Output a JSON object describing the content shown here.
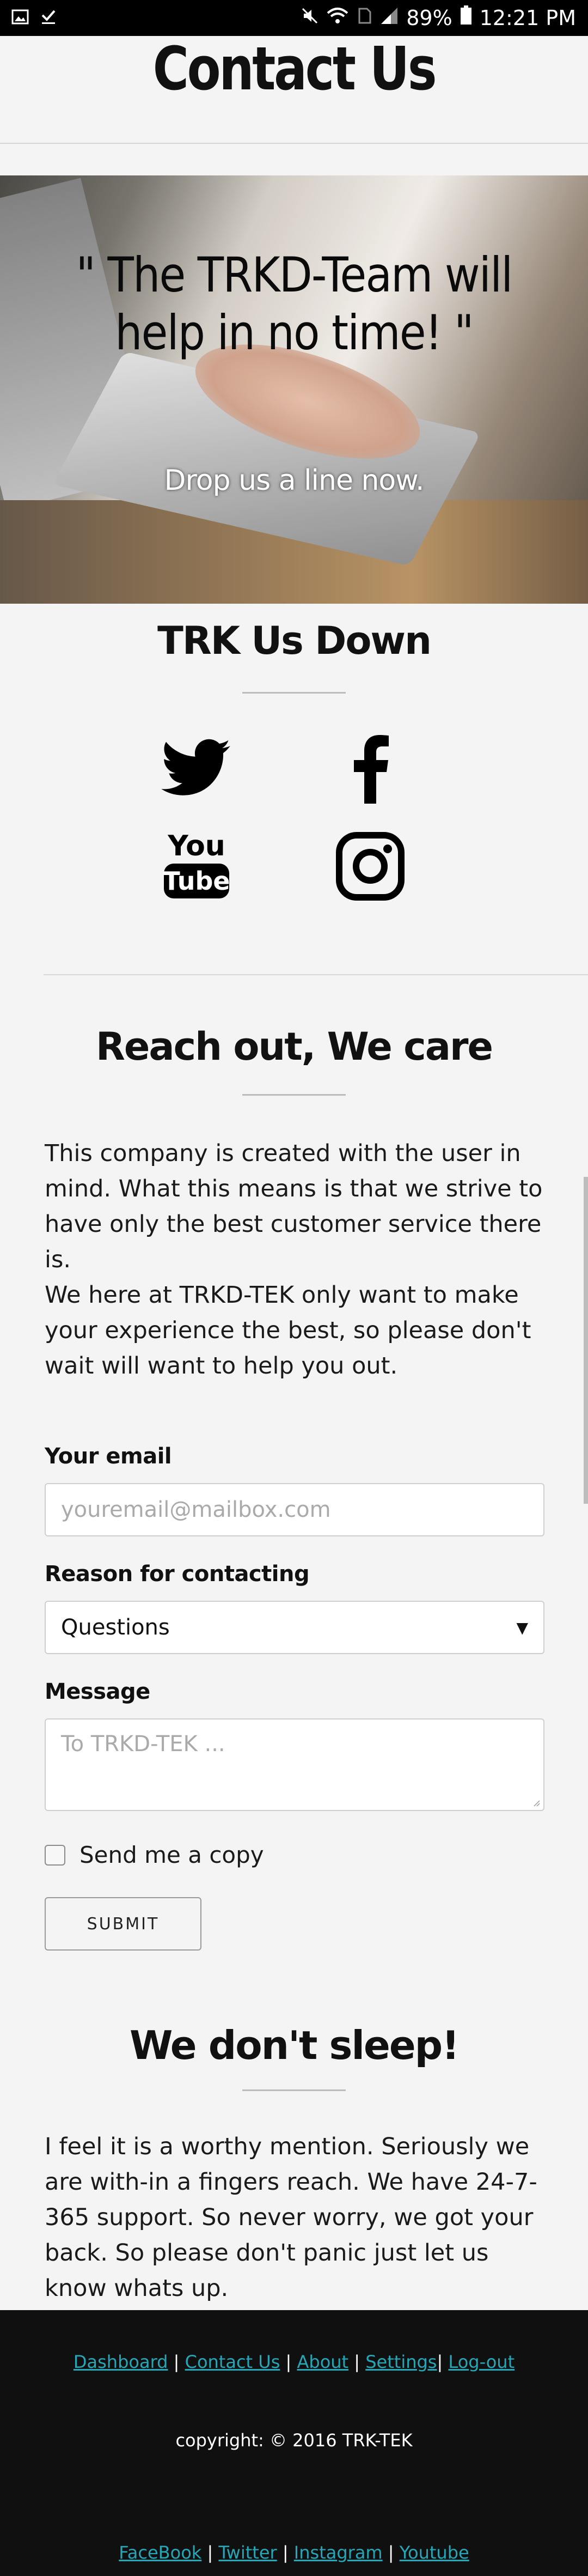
{
  "status_bar": {
    "battery": "89%",
    "time": "12:21 PM",
    "icons": [
      "gallery-icon",
      "download-done-icon",
      "mute-icon",
      "wifi-icon",
      "no-sim-icon",
      "signal-icon",
      "battery-icon"
    ]
  },
  "header": {
    "title": "Contact Us"
  },
  "hero": {
    "quote": "\" The TRKD-Team will help in no time! \"",
    "subtitle": "Drop us a line now."
  },
  "social": {
    "title": "TRK Us Down",
    "icons": [
      "twitter-icon",
      "facebook-icon",
      "youtube-icon",
      "instagram-icon"
    ]
  },
  "reach": {
    "title": "Reach out, We care",
    "paragraph_1": "This company is created with the user in mind. What this means is that we strive to have only the best customer service there is.",
    "paragraph_2": "We here at TRKD-TEK only want to make your experience the best, so please don't wait will want to help you out."
  },
  "form": {
    "email_label": "Your email",
    "email_placeholder": "youremail@mailbox.com",
    "reason_label": "Reason for contacting",
    "reason_value": "Questions",
    "message_label": "Message",
    "message_placeholder": "To TRKD-TEK ...",
    "copy_label": "Send me a copy",
    "submit_label": "SUBMIT"
  },
  "sleep": {
    "title": "We don't sleep!",
    "paragraph": "I feel it is a worthy mention. Seriously we are with-in a fingers reach. We have 24-7-365 support. So never worry, we got your back. So please don't panic just let us know whats up."
  },
  "footer": {
    "nav": [
      "Dashboard",
      "Contact Us",
      "About",
      "Settings",
      "Log-out"
    ],
    "copyright": "copyright: © 2016 TRK-TEK",
    "social": [
      "FaceBook",
      "Twitter",
      "Instagram",
      "Youtube"
    ],
    "link_color": "#26a7b8"
  }
}
